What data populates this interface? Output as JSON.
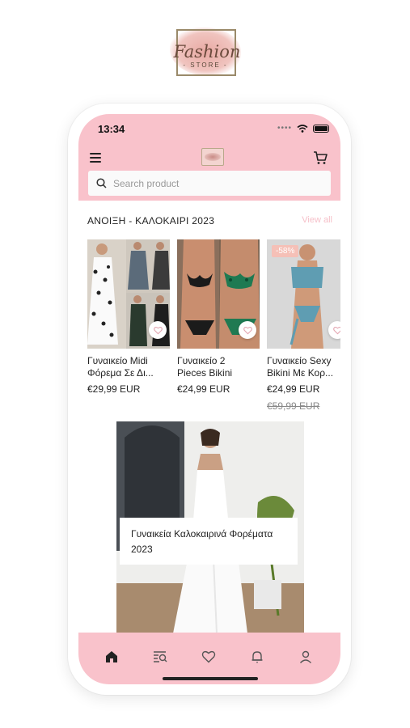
{
  "brand": {
    "script": "Fashion",
    "store": "STORE"
  },
  "status_bar": {
    "time": "13:34"
  },
  "header": {
    "menu_icon": "hamburger-menu-icon",
    "logo_icon": "fashion-store-logo-icon",
    "cart_icon": "shopping-cart-icon"
  },
  "search": {
    "placeholder": "Search product",
    "value": "",
    "icon": "search-icon"
  },
  "section": {
    "title": "ΑΝΟΙΞΗ - ΚΑΛΟΚΑΙΡΙ 2023",
    "view_all": "View all"
  },
  "products": [
    {
      "name_line1": "Γυναικείο Midi",
      "name_line2": "Φόρεμα Σε Δι...",
      "price": "€29,99 EUR",
      "old_price": "",
      "badge": ""
    },
    {
      "name_line1": "Γυναικείο 2",
      "name_line2": "Pieces Bikini",
      "price": "€24,99 EUR",
      "old_price": "",
      "badge": ""
    },
    {
      "name_line1": "Γυναικείο Sexy",
      "name_line2": "Bikini Με Κορ...",
      "price": "€24,99 EUR",
      "old_price": "€59,99 EUR",
      "badge": "-58%"
    }
  ],
  "banner": {
    "caption_line1": "Γυναικεία Καλοκαιρινά Φορέματα",
    "caption_line2": "2023"
  },
  "tabbar": {
    "items": [
      "home-icon",
      "search-list-icon",
      "heart-icon",
      "bell-icon",
      "user-icon"
    ],
    "active": "home-icon"
  },
  "colors": {
    "accent_pink": "#f9c2cb",
    "view_all": "#f6c0c9",
    "badge": "#f5c0b7"
  }
}
